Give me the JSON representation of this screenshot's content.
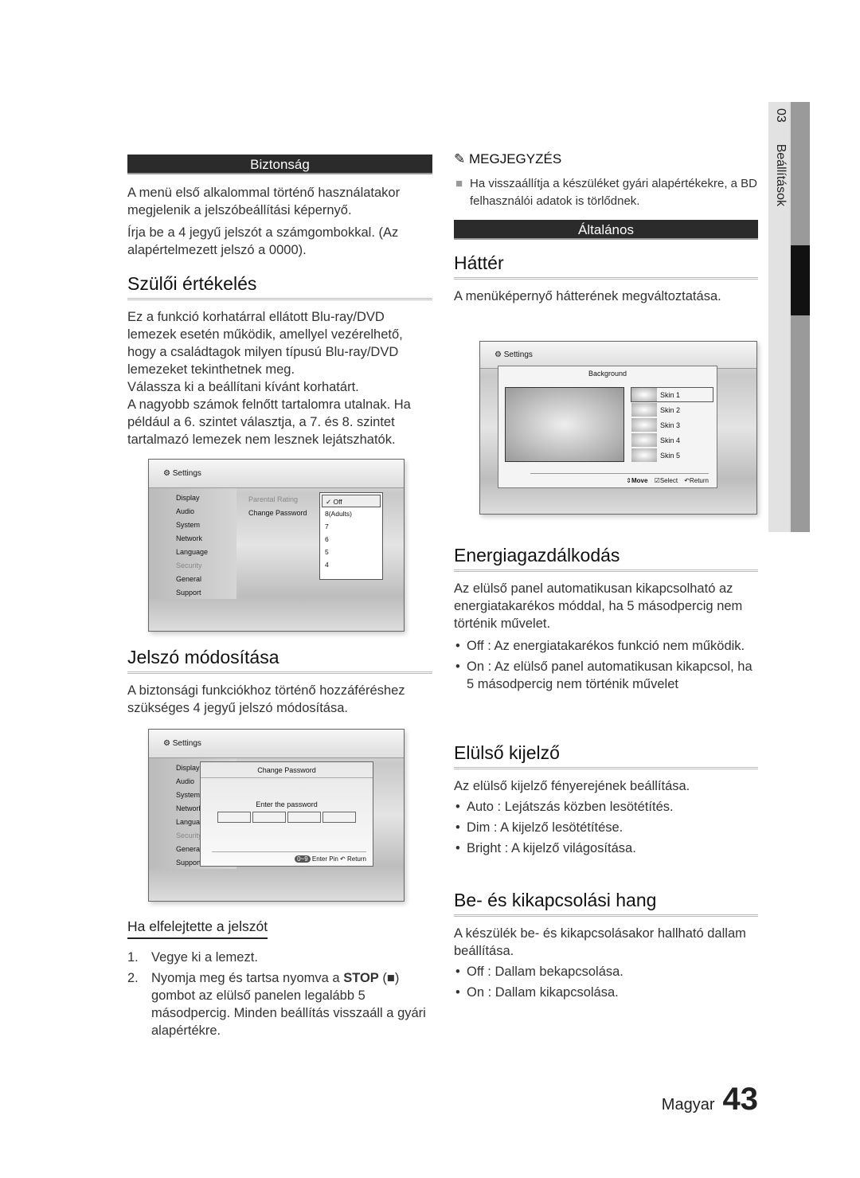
{
  "sidebar_tab": {
    "chapter": "03",
    "label": "Beállítások"
  },
  "left": {
    "security_header": "Biztonság",
    "security_p1": "A menü első alkalommal történő használatakor megjelenik a jelszóbeállítási képernyő.",
    "security_p2": "Írja be a 4 jegyű jelszót a számgombokkal. (Az alapértelmezett jelszó a 0000).",
    "parental": {
      "title": "Szülői értékelés",
      "p1": "Ez a funkció korhatárral ellátott Blu-ray/DVD lemezek esetén működik, amellyel vezérelhető, hogy a családtagok milyen típusú Blu-ray/DVD lemezeket tekinthetnek meg.",
      "p2": "Válassza ki a beállítani kívánt korhatárt.",
      "p3": "A nagyobb számok felnőtt tartalomra utalnak. Ha például a 6. szintet választja, a 7. és 8. szintet tartalmazó lemezek nem lesznek lejátszhatók."
    },
    "screen1": {
      "title": "Settings",
      "menu": [
        "Display",
        "Audio",
        "System",
        "Network",
        "Language",
        "Security",
        "General",
        "Support"
      ],
      "options": [
        "Parental Rating",
        "Change Password"
      ],
      "ratings": [
        "✓ Off",
        "8(Adults)",
        "7",
        "6",
        "5",
        "4"
      ]
    },
    "password": {
      "title": "Jelszó módosítása",
      "p1": "A biztonsági funkciókhoz történő hozzáféréshez szükséges 4 jegyű jelszó módosítása."
    },
    "screen2": {
      "title": "Settings",
      "menu": [
        "Display",
        "Audio",
        "System",
        "Network",
        "Language",
        "Security",
        "General",
        "Support"
      ],
      "dialog_title": "Change Password",
      "prompt": "Enter the password",
      "key": "0~9",
      "enter_pin": "Enter Pin",
      "return": "Return"
    },
    "forgot": {
      "title": "Ha elfelejtette a jelszót",
      "steps": [
        {
          "n": "1.",
          "text": "Vegye ki a lemezt."
        },
        {
          "n": "2.",
          "pre": "Nyomja meg és tartsa nyomva a ",
          "bold": "STOP",
          "post": " (■) gombot az elülső panelen legalább 5 másodpercig. Minden beállítás visszaáll a gyári alapértékre."
        }
      ]
    }
  },
  "right": {
    "note_title": "MEGJEGYZÉS",
    "note_text": "Ha visszaállítja a készüléket gyári alapértékekre, a BD felhasználói adatok is törlődnek.",
    "general_header": "Általános",
    "background": {
      "title": "Háttér",
      "p1": "A menüképernyő hátterének megváltoztatása."
    },
    "screen3": {
      "title": "Settings",
      "dialog_title": "Background",
      "skins": [
        "Skin 1",
        "Skin 2",
        "Skin 3",
        "Skin 4",
        "Skin 5"
      ],
      "move": "Move",
      "select": "Select",
      "return": "Return"
    },
    "energy": {
      "title": "Energiagazdálkodás",
      "p1": "Az elülső panel automatikusan kikapcsolható az energiatakarékos móddal, ha 5 másodpercig nem történik művelet.",
      "items": [
        {
          "k": "Off",
          "v": " : Az energiatakarékos funkció nem működik."
        },
        {
          "k": "On",
          "v": " : Az elülső panel automatikusan kikapcsol, ha 5 másodpercig nem történik művelet"
        }
      ]
    },
    "display": {
      "title": "Elülső kijelző",
      "p1": "Az elülső kijelző fényerejének beállítása.",
      "items": [
        {
          "k": "Auto",
          "v": " : Lejátszás közben lesötétítés."
        },
        {
          "k": "Dim",
          "v": " : A kijelző lesötétítése."
        },
        {
          "k": "Bright",
          "v": " : A kijelző világosítása."
        }
      ]
    },
    "sound": {
      "title": "Be- és kikapcsolási hang",
      "p1": "A készülék be- és kikapcsolásakor hallható dallam beállítása.",
      "items": [
        {
          "k": "Off",
          "v": " : Dallam bekapcsolása."
        },
        {
          "k": "On",
          "v": " : Dallam kikapcsolása."
        }
      ]
    }
  },
  "footer": {
    "language": "Magyar",
    "page": "43"
  }
}
